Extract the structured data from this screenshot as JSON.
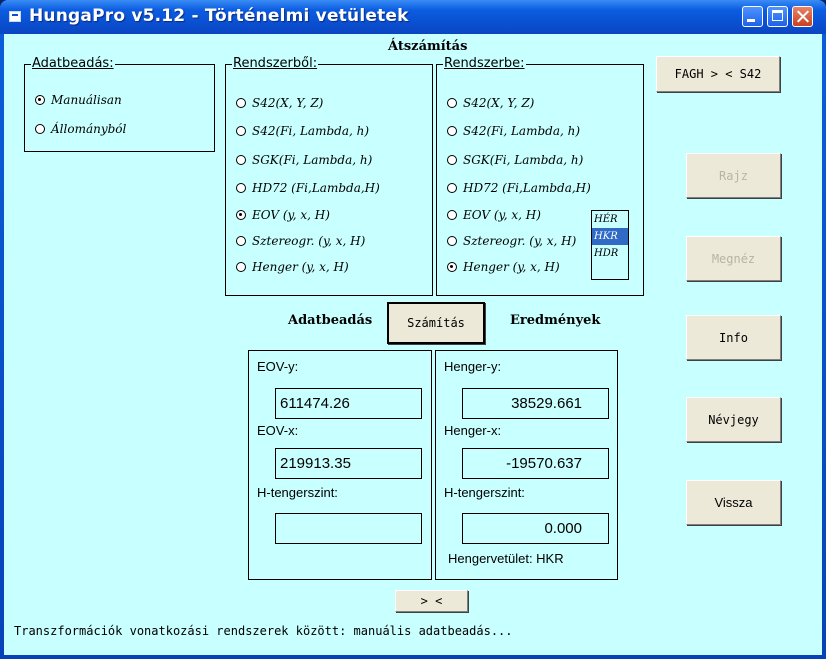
{
  "window": {
    "title": "HungaPro v5.12 - Történelmi vetületek"
  },
  "main": {
    "heading": "Átszámítás",
    "input_heading": "Adatbeadás",
    "results_heading": "Eredmények",
    "calculate_label": "Számítás"
  },
  "data_entry": {
    "legend": "Adatbeadás:",
    "options": [
      "Manuálisan",
      "Állományból"
    ],
    "selected": "Manuálisan"
  },
  "from_system": {
    "legend": "Rendszerből:",
    "options": [
      "S42(X, Y, Z)",
      "S42(Fi, Lambda, h)",
      "SGK(Fi, Lambda, h)",
      "HD72 (Fi,Lambda,H)",
      "EOV (y, x, H)",
      "Sztereogr. (y, x, H)",
      "Henger (y, x, H)"
    ],
    "selected": "EOV (y, x, H)"
  },
  "to_system": {
    "legend": "Rendszerbe:",
    "options": [
      "S42(X, Y, Z)",
      "S42(Fi, Lambda, h)",
      "SGK(Fi, Lambda, h)",
      "HD72 (Fi,Lambda,H)",
      "EOV (y, x, H)",
      "Sztereogr. (y, x, H)",
      "Henger (y, x, H)"
    ],
    "selected": "Henger (y, x, H)",
    "cylinder_list": [
      "HÉR",
      "HKR",
      "HDR"
    ],
    "cylinder_selected": "HKR"
  },
  "input_fields": {
    "y_label": "EOV-y:",
    "y_value": "611474.26",
    "x_label": "EOV-x:",
    "x_value": "219913.35",
    "h_label": "H-tengerszint:",
    "h_value": ""
  },
  "output_fields": {
    "y_label": "Henger-y:",
    "y_value": "38529.661",
    "x_label": "Henger-x:",
    "x_value": "-19570.637",
    "h_label": "H-tengerszint:",
    "h_value": "0.000",
    "projection_label": "Hengervetület: HKR"
  },
  "side_buttons": {
    "swap": "FAGH > < S42",
    "draw": "Rajz",
    "view": "Megnéz",
    "info": "Info",
    "about": "Névjegy",
    "back": "Vissza"
  },
  "swap_fields_label": "> <",
  "status": "Transzformációk vonatkozási rendszerek között: manuális adatbeadás..."
}
